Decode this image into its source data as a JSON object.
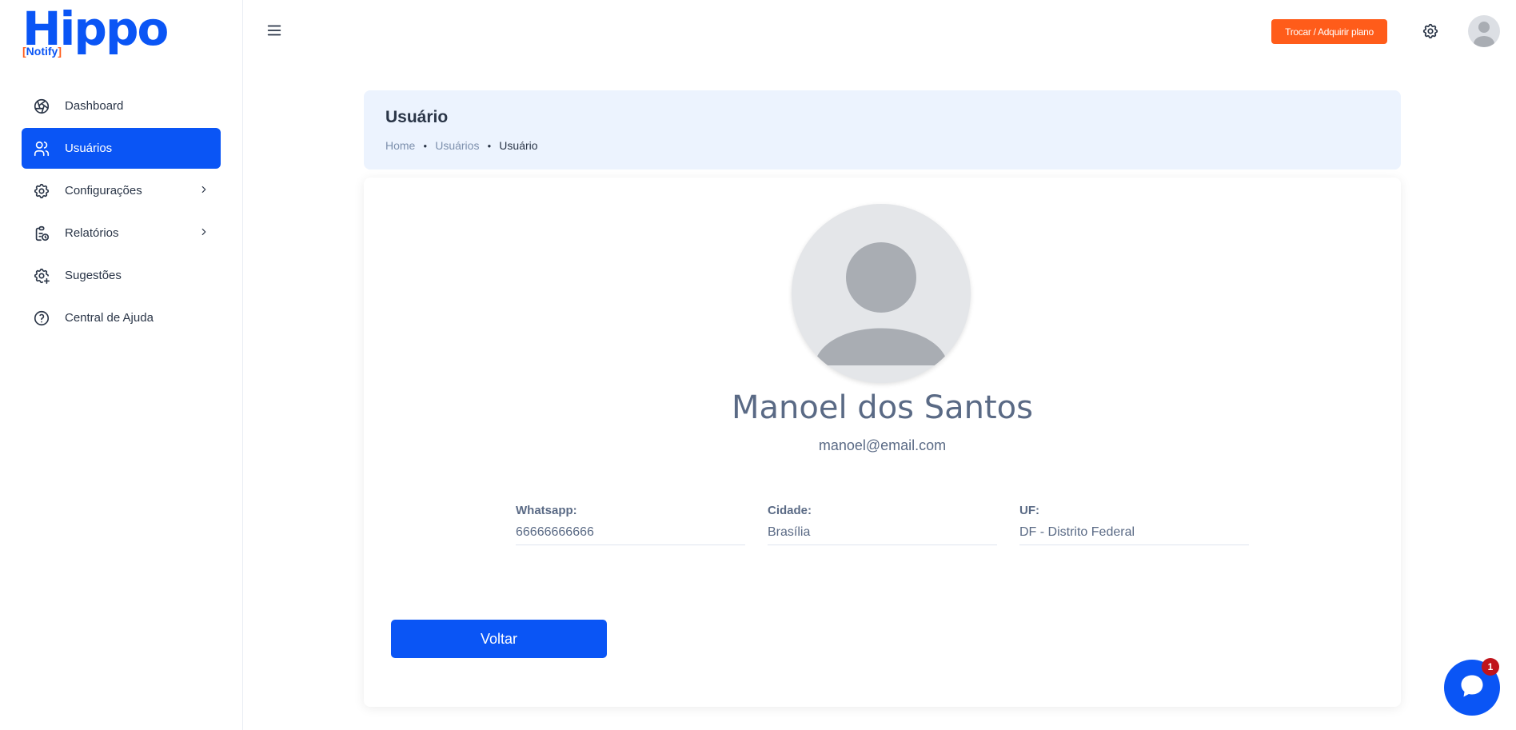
{
  "logo": {
    "wordmark": "Hippo",
    "subtitle_open": "[",
    "subtitle_text": "Notify",
    "subtitle_close": "]"
  },
  "sidebar": {
    "items": [
      {
        "label": "Dashboard",
        "icon": "aperture-icon",
        "active": false
      },
      {
        "label": "Usuários",
        "icon": "users-icon",
        "active": true
      },
      {
        "label": "Configurações",
        "icon": "gear-icon",
        "active": false,
        "has_submenu": true
      },
      {
        "label": "Relatórios",
        "icon": "clipboard-clock-icon",
        "active": false,
        "has_submenu": true
      },
      {
        "label": "Sugestões",
        "icon": "gear-plus-icon",
        "active": false
      },
      {
        "label": "Central de Ajuda",
        "icon": "help-circle-icon",
        "active": false
      }
    ]
  },
  "header": {
    "plan_button": "Trocar / Adquirir plano"
  },
  "page": {
    "title": "Usuário",
    "breadcrumb": [
      "Home",
      "Usuários",
      "Usuário"
    ]
  },
  "profile": {
    "name": "Manoel dos Santos",
    "email": "manoel@email.com",
    "fields": [
      {
        "label": "Whatsapp:",
        "value": "66666666666"
      },
      {
        "label": "Cidade:",
        "value": "Brasília"
      },
      {
        "label": "UF:",
        "value": "DF - Distrito Federal"
      }
    ],
    "back_button": "Voltar"
  },
  "chat": {
    "badge_count": "1"
  },
  "colors": {
    "primary": "#0a55f5",
    "accent": "#ff5c1a",
    "crumb_bg": "#ecf3fe",
    "badge": "#c0141c"
  }
}
